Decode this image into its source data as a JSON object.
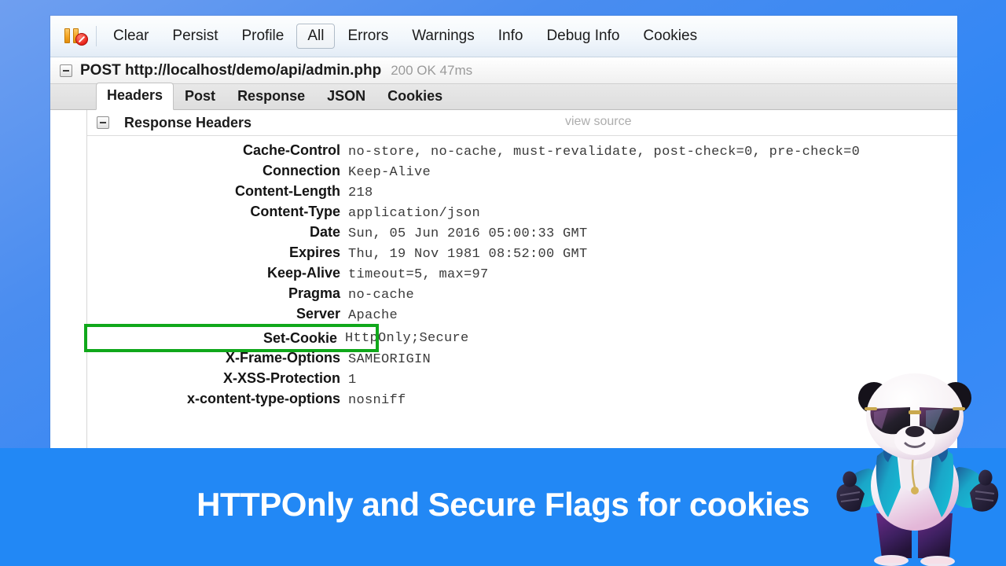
{
  "toolbar": {
    "icon_name": "pause-disabled-icon",
    "items": [
      {
        "label": "Clear",
        "selected": false
      },
      {
        "label": "Persist",
        "selected": false
      },
      {
        "label": "Profile",
        "selected": false
      },
      {
        "label": "All",
        "selected": true
      },
      {
        "label": "Errors",
        "selected": false
      },
      {
        "label": "Warnings",
        "selected": false
      },
      {
        "label": "Info",
        "selected": false
      },
      {
        "label": "Debug Info",
        "selected": false
      },
      {
        "label": "Cookies",
        "selected": false
      }
    ]
  },
  "request": {
    "method_url": "POST http://localhost/demo/api/admin.php",
    "status": "200 OK 47ms"
  },
  "tabs": [
    {
      "label": "Headers",
      "active": true
    },
    {
      "label": "Post",
      "active": false
    },
    {
      "label": "Response",
      "active": false
    },
    {
      "label": "JSON",
      "active": false
    },
    {
      "label": "Cookies",
      "active": false
    }
  ],
  "section": {
    "title": "Response Headers",
    "view_source": "view source"
  },
  "headers": [
    {
      "name": "Cache-Control",
      "value": "no-store, no-cache, must-revalidate, post-check=0, pre-check=0",
      "highlight": false
    },
    {
      "name": "Connection",
      "value": "Keep-Alive",
      "highlight": false
    },
    {
      "name": "Content-Length",
      "value": "218",
      "highlight": false
    },
    {
      "name": "Content-Type",
      "value": "application/json",
      "highlight": false
    },
    {
      "name": "Date",
      "value": "Sun, 05 Jun 2016 05:00:33 GMT",
      "highlight": false
    },
    {
      "name": "Expires",
      "value": "Thu, 19 Nov 1981 08:52:00 GMT",
      "highlight": false
    },
    {
      "name": "Keep-Alive",
      "value": "timeout=5, max=97",
      "highlight": false
    },
    {
      "name": "Pragma",
      "value": "no-cache",
      "highlight": false
    },
    {
      "name": "Server",
      "value": "Apache",
      "highlight": false
    },
    {
      "name": "Set-Cookie",
      "value": "HttpOnly;Secure",
      "highlight": true
    },
    {
      "name": "X-Frame-Options",
      "value": "SAMEORIGIN",
      "highlight": false
    },
    {
      "name": "X-XSS-Protection",
      "value": "1",
      "highlight": false
    },
    {
      "name": "x-content-type-options",
      "value": "nosniff",
      "highlight": false
    }
  ],
  "banner": {
    "caption": "HTTPOnly and Secure Flags for cookies",
    "background_color": "#2288f5",
    "text_color": "#ffffff"
  },
  "mascot": {
    "name": "panda-mascot-thumbs-up"
  },
  "colors": {
    "highlight_green": "#10a81b",
    "page_blue": "#2f86f5",
    "status_gray": "#9a9a9a"
  }
}
